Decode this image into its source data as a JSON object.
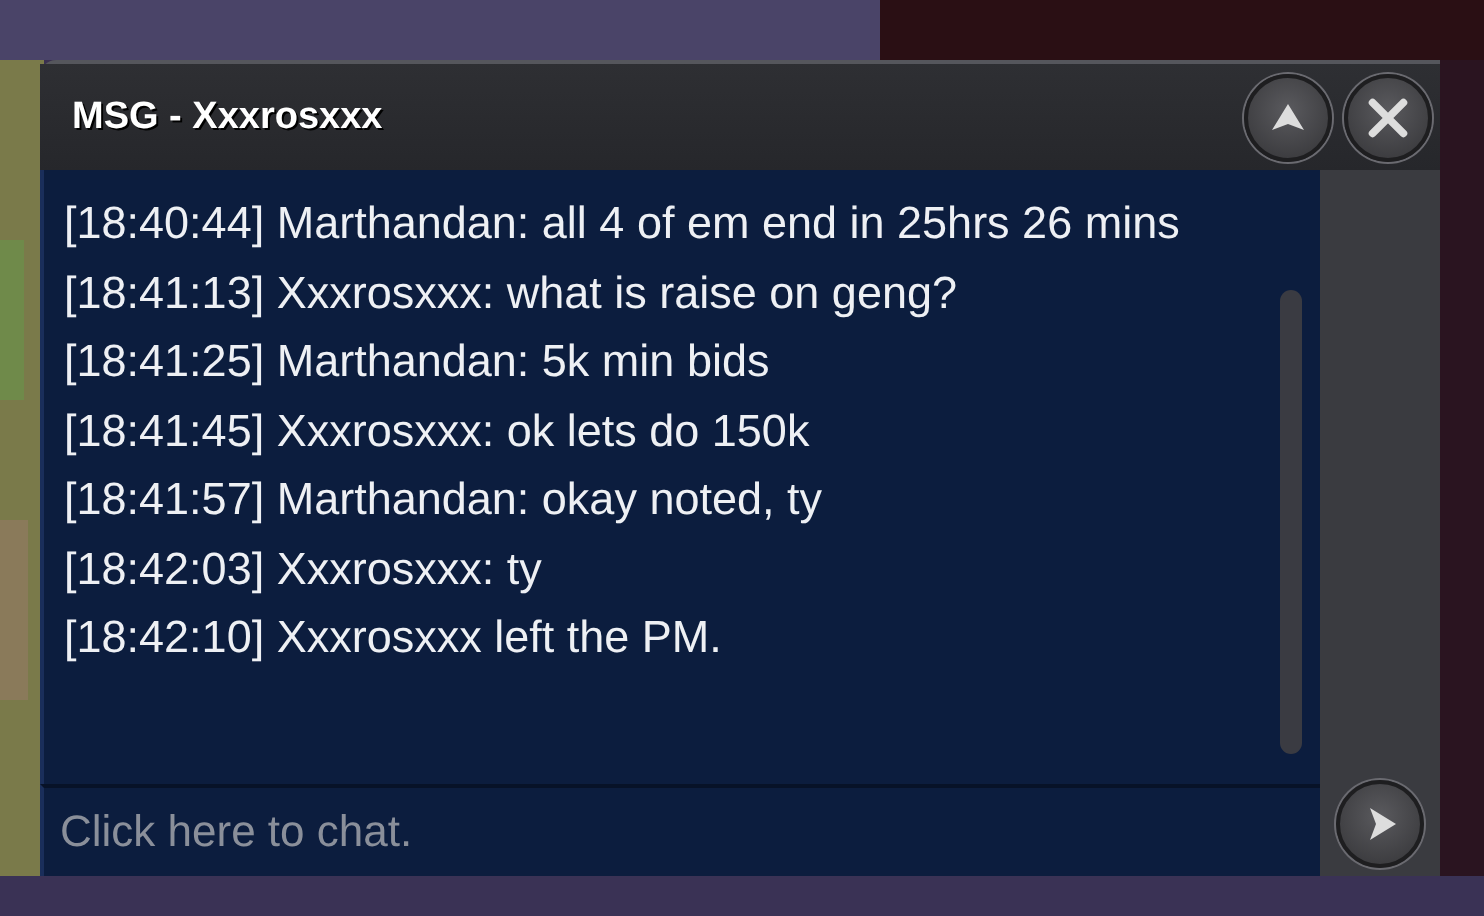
{
  "window": {
    "title": "MSG - Xxxrosxxx"
  },
  "messages": [
    {
      "text": "[18:40:44] Marthandan: all 4 of em end in 25hrs 26 mins"
    },
    {
      "text": "[18:41:13] Xxxrosxxx: what is raise on geng?"
    },
    {
      "text": "[18:41:25] Marthandan: 5k min bids"
    },
    {
      "text": "[18:41:45] Xxxrosxxx: ok lets do 150k"
    },
    {
      "text": "[18:41:57] Marthandan: okay noted, ty"
    },
    {
      "text": "[18:42:03] Xxxrosxxx: ty"
    },
    {
      "text": "[18:42:10] Xxxrosxxx left the PM."
    }
  ],
  "chat_input": {
    "placeholder": "Click here to chat."
  }
}
